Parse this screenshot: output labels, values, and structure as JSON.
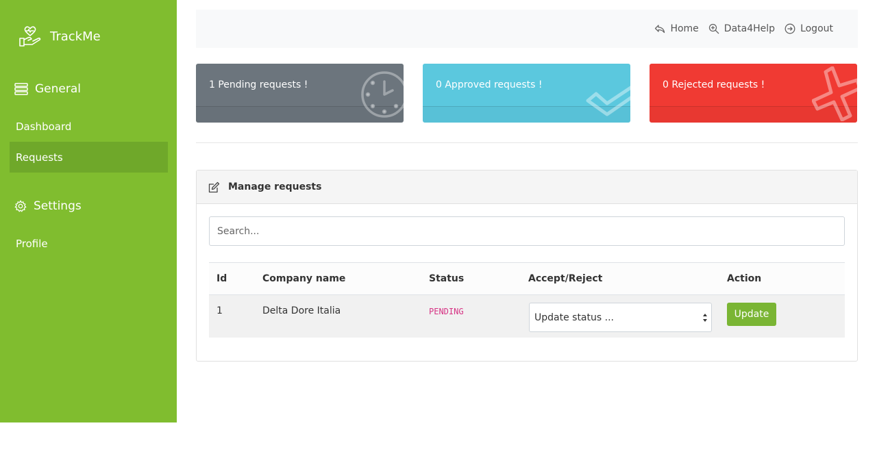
{
  "app": {
    "name": "TrackMe"
  },
  "sidebar": {
    "general_label": "General",
    "settings_label": "Settings",
    "items": [
      {
        "label": "Dashboard",
        "active": false
      },
      {
        "label": "Requests",
        "active": true
      },
      {
        "label": "Profile",
        "active": false
      }
    ]
  },
  "topnav": {
    "home": "Home",
    "data4help": "Data4Help",
    "logout": "Logout"
  },
  "stats": {
    "pending": "1 Pending requests !",
    "approved": "0 Approved requests !",
    "rejected": "0 Rejected requests !"
  },
  "manage": {
    "title": "Manage requests",
    "search_placeholder": "Search...",
    "columns": [
      "Id",
      "Company name",
      "Status",
      "Accept/Reject",
      "Action"
    ],
    "rows": [
      {
        "id": "1",
        "company": "Delta Dore Italia",
        "status": "PENDING",
        "select_value": "Update status ...",
        "action": "Update"
      }
    ]
  },
  "colors": {
    "sidebar": "#80bd2f",
    "pending": "#6c757d",
    "approved": "#5bc8de",
    "rejected": "#f03a33",
    "button": "#7ab534"
  }
}
